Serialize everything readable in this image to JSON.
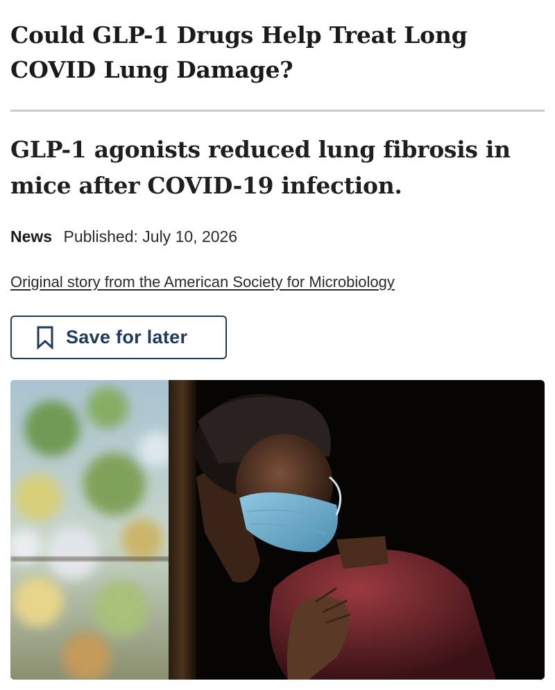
{
  "article": {
    "title": "Could GLP-1 Drugs Help Treat Long COVID Lung Damage?",
    "subtitle": "GLP-1 agonists reduced lung fibrosis in mice after COVID-19 infection.",
    "category": "News",
    "published": "Published: July 10, 2026",
    "source_link": "Original story from the American Society for Microbiology"
  },
  "actions": {
    "save_label": "Save for later",
    "save_icon": "bookmark-icon"
  },
  "colors": {
    "accent": "#1f3a5b",
    "divider": "#c9c9c9",
    "text": "#1a1a1a"
  },
  "hero_image": {
    "description_icon": "photo-man-wearing-face-mask"
  }
}
